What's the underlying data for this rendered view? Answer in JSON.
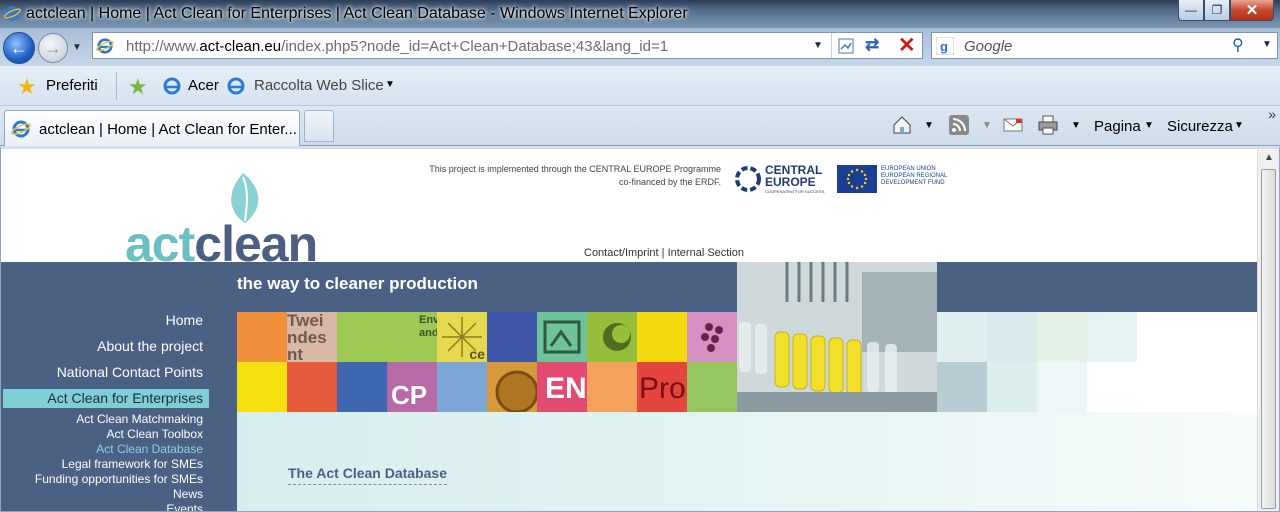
{
  "window": {
    "title": "actclean | Home | Act Clean for Enterprises | Act Clean Database - Windows Internet Explorer",
    "minimize": "—",
    "restore": "❐",
    "close": "✕"
  },
  "address_bar": {
    "url_prefix": "http://www.",
    "url_domain": "act-clean.eu",
    "url_path": "/index.php5?node_id=Act+Clean+Database;43&lang_id=1"
  },
  "search": {
    "placeholder": "Google"
  },
  "favorites_bar": {
    "favorites_label": "Preferiti",
    "acer_label": "Acer",
    "web_slice_label": "Raccolta Web Slice"
  },
  "tab": {
    "label": "actclean | Home | Act Clean for Enter..."
  },
  "command_bar": {
    "page_label": "Pagina",
    "safety_label": "Sicurezza"
  },
  "site": {
    "logo_text_a": "act",
    "logo_text_b": "clean",
    "programme_line1": "This project is implemented through the CENTRAL EUROPE Programme",
    "programme_line2": "co-financed by the ERDF.",
    "ce_logo_line1": "CENTRAL",
    "ce_logo_line2": "EUROPE",
    "ce_logo_tag": "COOPERATING FOR SUCCESS.",
    "eu_logo_line1": "EUROPEAN UNION",
    "eu_logo_line2": "EUROPEAN REGIONAL",
    "eu_logo_line3": "DEVELOPMENT FUND",
    "contact_link": "Contact/Imprint",
    "link_sep": "|",
    "internal_link": "Internal Section",
    "tagline": "the way to cleaner production",
    "menu": [
      "Home",
      "About the project",
      "National Contact Points",
      "Act Clean for Enterprises"
    ],
    "submenu": [
      "Act Clean Matchmaking",
      "Act Clean Toolbox",
      "Act Clean Database",
      "Legal framework for SMEs",
      "Funding opportunities for SMEs",
      "News",
      "Events"
    ],
    "content_title": "The Act Clean Database",
    "tile_text": [
      "Twei",
      "ndes",
      "nt",
      "Env",
      "and",
      "ce",
      "CP",
      "EN",
      "Pro"
    ]
  },
  "colors": {
    "band": "#4b6183",
    "accent": "#7fd0d4",
    "content_bg": "#d7eeef"
  }
}
